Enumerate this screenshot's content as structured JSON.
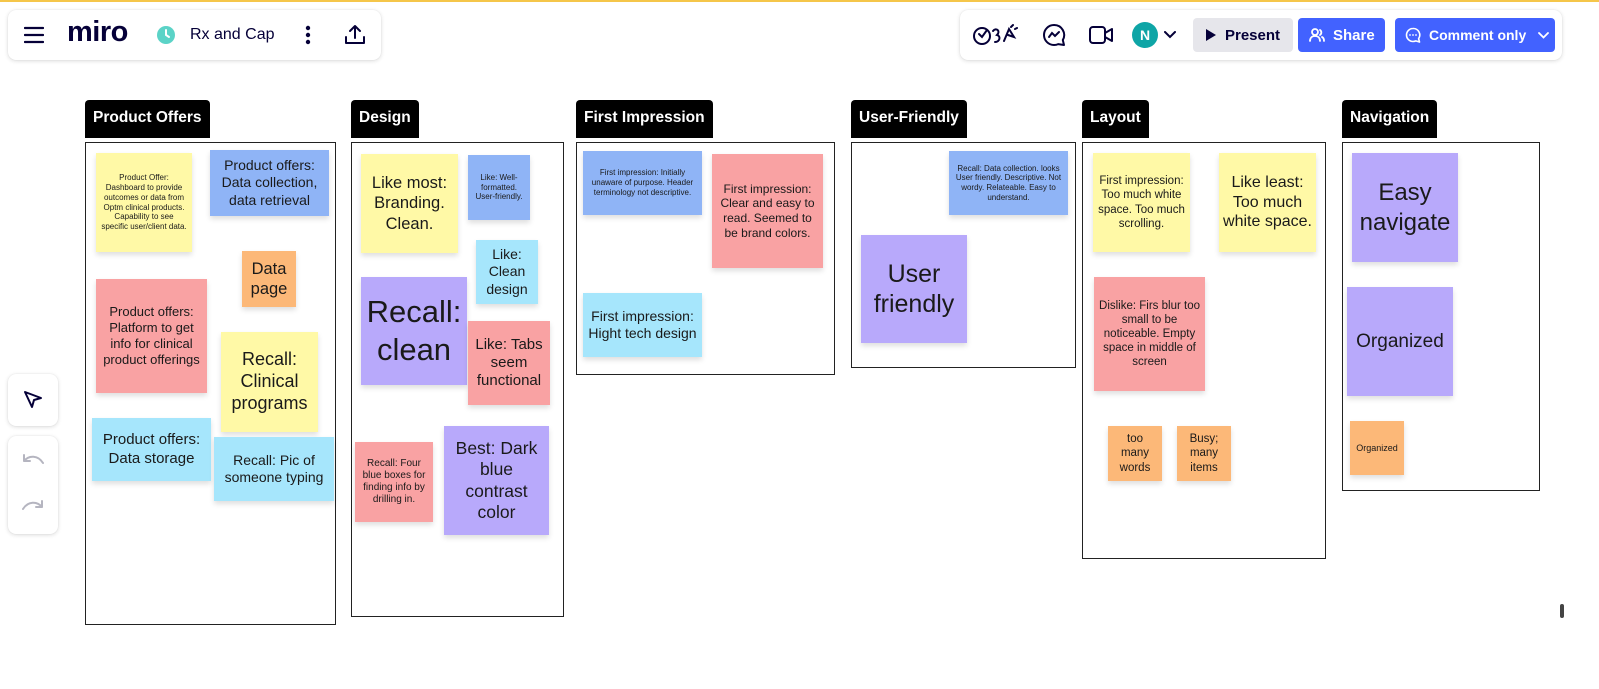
{
  "app": {
    "logo": "miro",
    "board_name": "Rx and Cap",
    "icons": {
      "menu": "menu-icon",
      "board_status": "clock-icon",
      "more": "more-vertical-icon",
      "export": "upload-icon"
    }
  },
  "collab": {
    "avatar_initial": "N",
    "present_label": "Present",
    "share_label": "Share",
    "comment_only_label": "Comment only",
    "icons": [
      "reactions-icon",
      "chat-icon",
      "video-icon"
    ]
  },
  "colors": {
    "accent": "#4262ff",
    "avatar": "#0ea5a6",
    "yellow": "#fff9a6",
    "blue": "#8fb4f6",
    "cyan": "#a6e6fc",
    "red": "#f9a2a3",
    "orange": "#fcb878",
    "purple": "#b8a9fb"
  },
  "frames": [
    {
      "title": "Product Offers",
      "notes": [
        {
          "text": "Product Offer: Dashboard to provide outcomes or data from Optm clinical products. Capability to see specific user/client data.",
          "color": "yellow"
        },
        {
          "text": "Product offers: Data collection, data retrieval",
          "color": "blue"
        },
        {
          "text": "Data page",
          "color": "orange"
        },
        {
          "text": "Product offers: Platform to get info for clinical product offerings",
          "color": "red"
        },
        {
          "text": "Recall: Clinical programs",
          "color": "yellow"
        },
        {
          "text": "Product offers: Data storage",
          "color": "cyan"
        },
        {
          "text": "Recall: Pic of someone typing",
          "color": "cyan"
        }
      ]
    },
    {
      "title": "Design",
      "notes": [
        {
          "text": "Like most: Branding. Clean.",
          "color": "yellow"
        },
        {
          "text": "Like: Well-formatted. User-friendly.",
          "color": "blue"
        },
        {
          "text": "Like: Clean design",
          "color": "cyan"
        },
        {
          "text": "Recall: clean",
          "color": "purple"
        },
        {
          "text": "Like: Tabs seem functional",
          "color": "red"
        },
        {
          "text": "Recall: Four blue boxes for finding info by drilling in.",
          "color": "red"
        },
        {
          "text": "Best: Dark blue contrast color",
          "color": "purple"
        }
      ]
    },
    {
      "title": "First Impression",
      "notes": [
        {
          "text": "First impression: Initially unaware of purpose. Header terminology not descriptive.",
          "color": "blue"
        },
        {
          "text": "First impression: Clear and easy to read. Seemed to be brand colors.",
          "color": "red"
        },
        {
          "text": "First impression: Hight tech design",
          "color": "cyan"
        }
      ]
    },
    {
      "title": "User-Friendly",
      "notes": [
        {
          "text": "Recall: Data collection. looks User friendly. Descriptive. Not wordy. Relateable. Easy to understand.",
          "color": "blue"
        },
        {
          "text": "User friendly",
          "color": "purple"
        }
      ]
    },
    {
      "title": "Layout",
      "notes": [
        {
          "text": "First impression: Too much white space. Too much scrolling.",
          "color": "yellow"
        },
        {
          "text": "Like least: Too much white space.",
          "color": "yellow"
        },
        {
          "text": "Dislike: Firs blur too small to be noticeable. Empty space in middle of screen",
          "color": "red"
        },
        {
          "text": "too many words",
          "color": "orange"
        },
        {
          "text": "Busy; many items",
          "color": "orange"
        }
      ]
    },
    {
      "title": "Navigation",
      "notes": [
        {
          "text": "Easy navigate",
          "color": "purple"
        },
        {
          "text": "Organized",
          "color": "purple"
        },
        {
          "text": "Organized",
          "color": "orange"
        }
      ]
    }
  ],
  "left_toolbar": {
    "tools": [
      "select-icon"
    ],
    "history": [
      "undo-icon",
      "redo-icon"
    ]
  }
}
